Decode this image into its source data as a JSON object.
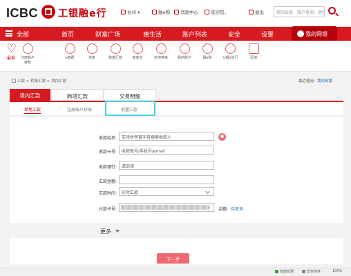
{
  "header": {
    "logo_text": "ICBC",
    "logo_cn": "工银融e行",
    "location": "台州",
    "links": [
      "融e购",
      "消息中心",
      "欢迎您，",
      "退出"
    ],
    "search_placeholder": "我的自助、账户查询、虎年转"
  },
  "nav": {
    "all": "全部",
    "items": [
      "首页",
      "财富广场",
      "惠生活",
      "账户列表",
      "安全",
      "设置"
    ],
    "mybank": "我的网银"
  },
  "quick_icons": [
    {
      "label": "最爱",
      "icon": "heart-icon"
    },
    {
      "label": "注册账户\n转账",
      "icon": "transfer-icon"
    },
    {
      "label": "e缴费",
      "icon": "pay-icon"
    },
    {
      "label": "贷款",
      "icon": "loan-icon"
    },
    {
      "label": "跨境汇款",
      "icon": "remit-icon"
    },
    {
      "label": "基金宝",
      "icon": "fund-icon"
    },
    {
      "label": "本地特色",
      "icon": "local-icon"
    },
    {
      "label": "我的账户",
      "icon": "account-icon"
    },
    {
      "label": "融e购",
      "icon": "shop-icon"
    },
    {
      "label": "工银e生行",
      "icon": "life-icon"
    },
    {
      "label": "添加",
      "icon": "add-icon"
    }
  ],
  "breadcrumb": "汇款 > 转账汇款 > 境内汇款",
  "recent": {
    "label": "最近使用:",
    "link": "我的网银"
  },
  "tabs": [
    "境内汇款",
    "跨境汇款",
    "交易明细"
  ],
  "subtabs": [
    "单笔汇款",
    "注册账户转账",
    "批量汇款"
  ],
  "form": {
    "payee_name": {
      "label": "收款姓名:",
      "placeholder": "支持拼音首字母搜索收款人"
    },
    "payee_card": {
      "label": "收款卡号:",
      "placeholder": "收款账号/手机号/email"
    },
    "payee_bank": {
      "label": "收款银行:",
      "value": "请选择"
    },
    "amount": {
      "label": "汇款金额:",
      "value": ""
    },
    "remit_time": {
      "label": "汇款时间:",
      "value": "实时汇款"
    },
    "pay_card": {
      "label": "付款卡号:",
      "value": ""
    },
    "balance_label": "余额:",
    "balance_link": "待查询"
  },
  "more": "更多",
  "next_button": "下一步",
  "status_bar": [
    "智能检测",
    "安全控件"
  ],
  "zoom": "100%"
}
